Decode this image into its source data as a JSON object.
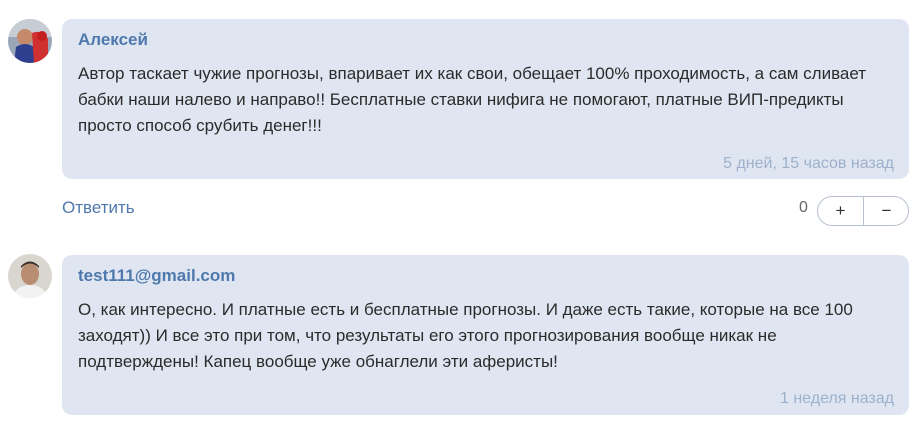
{
  "comments": [
    {
      "author": "Алексей",
      "text": "Автор таскает чужие прогнозы, впаривает их как свои, обещает 100% проходимость, а сам сливает бабки наши налево и направо!! Бесплатные ставки нифига не помогают, платные ВИП-предикты просто способ срубить денег!!!",
      "time": "5 дней, 15 часов назад",
      "reply_label": "Ответить",
      "votes": "0",
      "upvote_label": "+",
      "downvote_label": "−"
    },
    {
      "author": "test111@gmail.com",
      "text": "О, как интересно. И платные есть и бесплатные прогнозы. И даже есть такие, которые на все 100 заходят)) И все это при том, что результаты его этого прогнозирования вообще никак не подтверждены! Капец вообще уже обнаглели эти аферисты!",
      "time": "1 неделя назад"
    }
  ]
}
